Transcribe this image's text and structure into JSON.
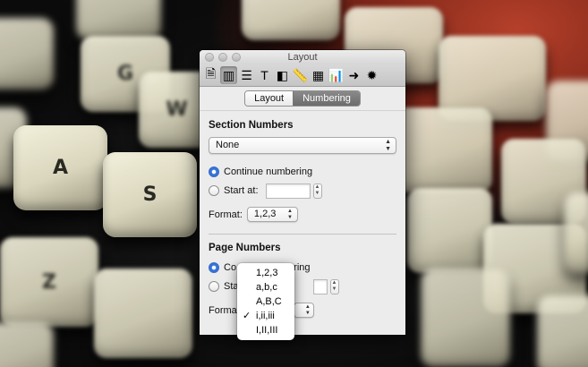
{
  "window": {
    "title": "Layout"
  },
  "toolbar": {
    "buttons": [
      {
        "name": "document",
        "icon": "document-icon",
        "glyph": "🗎"
      },
      {
        "name": "layout",
        "icon": "layout-icon",
        "glyph": "▥",
        "selected": true
      },
      {
        "name": "wrap",
        "icon": "wrap-icon",
        "glyph": "☰"
      },
      {
        "name": "text",
        "icon": "text-icon",
        "glyph": "T"
      },
      {
        "name": "graphic",
        "icon": "graphic-icon",
        "glyph": "◧"
      },
      {
        "name": "metrics",
        "icon": "ruler-icon",
        "glyph": "📏"
      },
      {
        "name": "table",
        "icon": "table-icon",
        "glyph": "▦"
      },
      {
        "name": "chart",
        "icon": "chart-icon",
        "glyph": "📊"
      },
      {
        "name": "link",
        "icon": "link-icon",
        "glyph": "➜"
      },
      {
        "name": "quicktime",
        "icon": "gear-icon",
        "glyph": "✹"
      }
    ]
  },
  "tabs": [
    {
      "label": "Layout",
      "active": false
    },
    {
      "label": "Numbering",
      "active": true
    }
  ],
  "section_numbers": {
    "title": "Section Numbers",
    "popup_value": "None",
    "continue_label": "Continue numbering",
    "start_at_label": "Start at:",
    "start_at_value": "",
    "format_label": "Format:",
    "format_value": "1,2,3",
    "selected": "continue"
  },
  "page_numbers": {
    "title": "Page Numbers",
    "continue_label_visible_left": "Co",
    "continue_label_visible_right": "ering",
    "start_at_label_visible": "Sta",
    "format_label_visible": "Forma",
    "selected": "continue"
  },
  "format_menu": {
    "items": [
      {
        "label": "1,2,3",
        "checked": false
      },
      {
        "label": "a,b,c",
        "checked": false
      },
      {
        "label": "A,B,C",
        "checked": false
      },
      {
        "label": "i,ii,iii",
        "checked": true
      },
      {
        "label": "I,II,III",
        "checked": false
      }
    ],
    "check_glyph": "✓"
  },
  "background_keys": [
    "G",
    "W",
    "A",
    "S",
    "Z"
  ],
  "colors": {
    "accent_radio": "#3a7be0",
    "active_tab": "#7a7a7a"
  }
}
